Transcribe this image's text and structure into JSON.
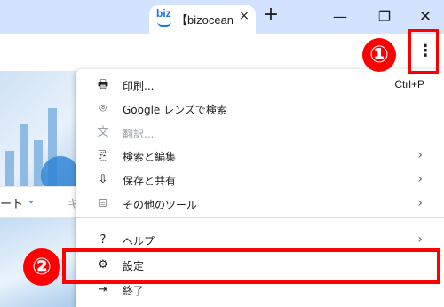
{
  "tab": {
    "favicon_text": "biz",
    "title": "【bizocean",
    "close": "×"
  },
  "new_tab": "+",
  "window": {
    "minimize": "—",
    "maximize": "❐",
    "close": "✕"
  },
  "kebab": "⋮",
  "annotations": {
    "badge1": "①",
    "badge2": "②"
  },
  "page": {
    "nav_text": "ート",
    "nav_chevron": "⌄",
    "nav_text2": "キ"
  },
  "menu": {
    "items": [
      {
        "icon": "printer-icon",
        "glyph": "🖶",
        "label": "印刷...",
        "shortcut": "Ctrl+P"
      },
      {
        "icon": "google-lens-icon",
        "glyph": "⌾",
        "label": "Google レンズで検索"
      },
      {
        "icon": "translate-icon",
        "glyph": "文",
        "label": "翻訳...",
        "disabled": true
      },
      {
        "icon": "find-edit-icon",
        "glyph": "⎘",
        "label": "検索と編集",
        "submenu": "›"
      },
      {
        "icon": "save-share-icon",
        "glyph": "⇩",
        "label": "保存と共有",
        "submenu": "›"
      },
      {
        "icon": "toolbox-icon",
        "glyph": "⌸",
        "label": "その他のツール",
        "submenu": "›"
      },
      {
        "icon": "help-icon",
        "glyph": "?",
        "label": "ヘルプ",
        "submenu": "›"
      },
      {
        "icon": "gear-icon",
        "glyph": "⚙",
        "label": "設定"
      },
      {
        "icon": "exit-icon",
        "glyph": "⇥",
        "label": "終了"
      }
    ]
  },
  "colors": {
    "annotation": "#ff0000",
    "titlebar": "#d3e3fd",
    "accent": "#1a73e8"
  }
}
